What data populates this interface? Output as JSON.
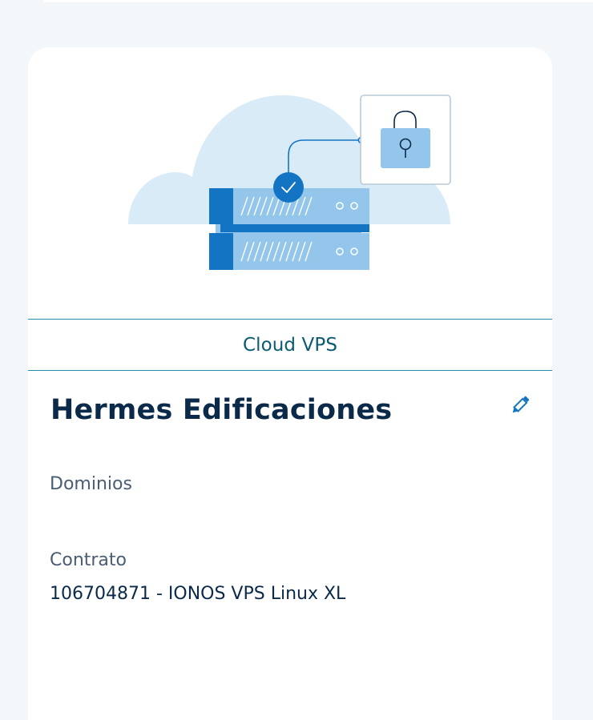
{
  "product": {
    "type": "Cloud VPS"
  },
  "server": {
    "name": "Hermes Edificaciones"
  },
  "sections": {
    "domains_label": "Dominios",
    "contract_label": "Contrato",
    "contract_value": "106704871 - IONOS VPS Linux XL"
  },
  "icons": {
    "edit": "pencil-icon",
    "illustration": "cloud-server-lock-illustration"
  },
  "colors": {
    "primary_blue": "#1474c4",
    "light_blue": "#93c6ea",
    "cloud": "#daebf8",
    "teal_text": "#0b5c73",
    "divider": "#1c8fa7",
    "heading": "#0b2a4a"
  }
}
